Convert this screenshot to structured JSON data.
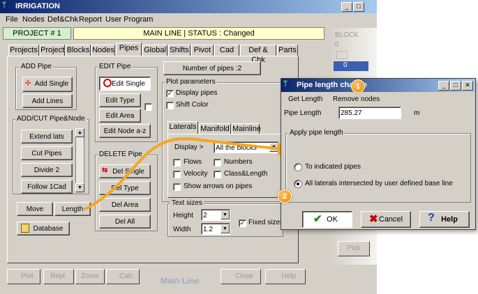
{
  "app": {
    "title": "IRRIGATION"
  },
  "menu": [
    "File",
    "Nodes",
    "Def&Chk",
    "Report",
    "User Program"
  ],
  "project": "PROJECT # 1",
  "status": "MAIN LINE  |  STATUS : Changed",
  "tabs": [
    "Projects",
    "Project",
    "Blocks",
    "Nodes",
    "Pipes",
    "Global",
    "Shifts",
    "Pivot",
    "Cad",
    "Def & Chk",
    "Parts"
  ],
  "active_tab": "Pipes",
  "add_pipe": {
    "title": "ADD Pipe",
    "add_single": "Add Single",
    "add_lines": "Add Lines"
  },
  "add_cut": {
    "title": "ADD/CUT Pipe&Node",
    "items": [
      "Extend lats",
      "Cut Pipes",
      "Divide 2",
      "Follow 1Cad"
    ]
  },
  "edit_pipe": {
    "title": "EDIT Pipe",
    "edit_single": "Edit Single",
    "edit_type": "Edit Type",
    "edit_area": "Edit Area",
    "edit_node": "Edit Node a-z"
  },
  "delete_pipe": {
    "title": "DELETE Pipe",
    "del_single": "Del Single",
    "del_type": "Del Type",
    "del_area": "Del Area",
    "del_all": "Del All"
  },
  "number_of_pipes": "Number of pipes :2",
  "plot_params": {
    "title": "Plot parameters",
    "display_pipes": "Display pipes",
    "shift_color": "Shift Color",
    "subtabs": [
      "Laterals",
      "Manifold",
      "Mainline"
    ],
    "display_label": "Display >",
    "display_value": "All the blocks",
    "flows": "Flows",
    "numbers": "Numbers",
    "velocity": "Velocity",
    "class_length": "Class&Length",
    "show_arrows": "Show arrows on pipes"
  },
  "text_sizes": {
    "title": "Text sizes",
    "height_label": "Height",
    "height_value": "2",
    "width_label": "Width",
    "width_value": "1.2",
    "fixed": "Fixed sizes"
  },
  "bottom": {
    "move": "Move",
    "length": "Length",
    "database": "Database"
  },
  "toolbar": {
    "plot": "Plot",
    "repl": "Repl.",
    "zoom": "Zoom",
    "calc": "Calc",
    "section": "Main Line",
    "close": "Close",
    "help": "Help"
  },
  "block_panel": {
    "title": "BLOCK",
    "count": "0",
    "item": "0",
    "pick": "Pick"
  },
  "dialog": {
    "title": "Pipe length change",
    "get_length": "Get Length",
    "remove_nodes": "Remove nodes",
    "pipe_length_label": "Pipe Length",
    "pipe_length_value": "285.27",
    "unit": "m",
    "apply_title": "Apply pipe length",
    "opt1": "To indicated pipes",
    "opt2": "All laterals intersected by user defined base line",
    "ok": "OK",
    "cancel": "Cancel",
    "help": "Help"
  },
  "callouts": [
    "1",
    "2"
  ],
  "colors": {
    "title_blue": "#0a246a",
    "status_yellow": "#ffffcc",
    "project_green": "#d3f0cb",
    "callout_orange": "#f5a623"
  }
}
